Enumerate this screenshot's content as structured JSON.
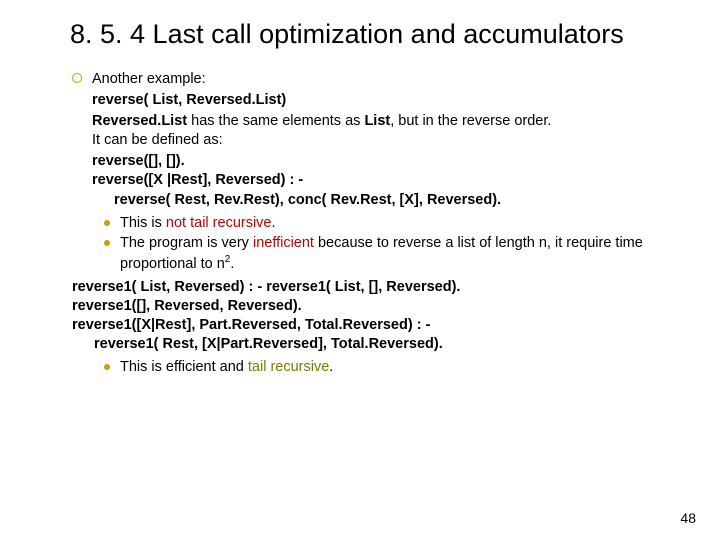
{
  "title": "8. 5. 4 Last call optimization and accumulators",
  "intro": "Another example:",
  "sig": "reverse( List, Reversed.List)",
  "desc_pre": "Reversed.List",
  "desc_mid": " has the same elements as ",
  "desc_list": "List",
  "desc_post": ", but in the reverse order.",
  "defined": "It can be defined as:",
  "code1_l1": "reverse([], []).",
  "code1_l2": "reverse([X |Rest], Reversed) : -",
  "code1_l3": "reverse( Rest, Rev.Rest), conc( Rev.Rest, [X], Reversed).",
  "sub1_pre": "This is ",
  "sub1_hl": "not tail recursive",
  "sub1_post": ".",
  "sub2_pre": "The program is very ",
  "sub2_hl": "inefficient",
  "sub2_post": " because to reverse a list of length n, it require time proportional to n",
  "sub2_exp": "2",
  "sub2_dot": ".",
  "code2_l1": "reverse1( List, Reversed) : - reverse1( List, [], Reversed).",
  "code2_l2": "reverse1([], Reversed, Reversed).",
  "code2_l3": "reverse1([X|Rest], Part.Reversed, Total.Reversed) : -",
  "code2_l4": "reverse1( Rest, [X|Part.Reversed], Total.Reversed).",
  "sub3_pre": "This is efficient and ",
  "sub3_hl": "tail recursive",
  "sub3_post": ".",
  "page": "48"
}
